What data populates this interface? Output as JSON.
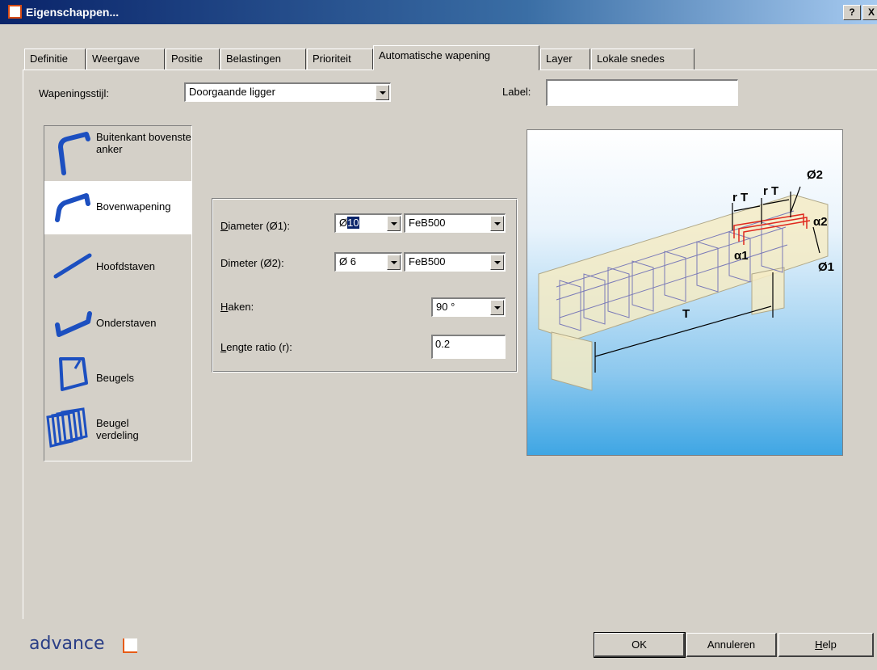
{
  "window": {
    "title": "Eigenschappen...",
    "help_btn": "?",
    "close_btn": "X"
  },
  "tabs": [
    {
      "label": "Definitie"
    },
    {
      "label": "Weergave"
    },
    {
      "label": "Positie"
    },
    {
      "label": "Belastingen"
    },
    {
      "label": "Prioriteit"
    },
    {
      "label": "Automatische wapening"
    },
    {
      "label": "Layer"
    },
    {
      "label": "Lokale snedes"
    }
  ],
  "active_tab": "Automatische wapening",
  "style": {
    "label": "Wapeningsstijl:",
    "value": "Doorgaande ligger"
  },
  "label_field": {
    "label": "Label:",
    "value": ""
  },
  "bar_types": [
    {
      "label": "Buitenkant bovenste anker",
      "icon": "top-anchor-bar-icon"
    },
    {
      "label": "Bovenwapening",
      "icon": "top-reinforcement-bar-icon",
      "selected": true
    },
    {
      "label": "Hoofdstaven",
      "icon": "main-bar-icon"
    },
    {
      "label": "Onderstaven",
      "icon": "bottom-bar-icon"
    },
    {
      "label": "Beugels",
      "icon": "stirrup-icon"
    },
    {
      "label": "Beugel verdeling",
      "icon": "stirrup-distribution-icon"
    }
  ],
  "settings": {
    "diameter1": {
      "prefix": "D",
      "label": "iameter (Ø1):",
      "symbol": "Ø",
      "value": "10",
      "grade": "FeB500"
    },
    "diameter2": {
      "prefix": "Di",
      "accel": "a",
      "label": "meter (Ø2):",
      "symbol": "Ø",
      "value": "6",
      "grade": "FeB500"
    },
    "hooks": {
      "prefix": "",
      "accel": "H",
      "label": "aken:",
      "value": "90 °"
    },
    "length_ratio": {
      "accel": "L",
      "label": "engte ratio (r):",
      "value": "0.2"
    }
  },
  "preview": {
    "labels": {
      "rT1": "r T",
      "rT2": "r T",
      "d2": "Ø2",
      "a2": "α2",
      "a1": "α1",
      "d1": "Ø1",
      "T": "T"
    }
  },
  "footer": {
    "logo": "advance",
    "ok": "OK",
    "cancel": "Annuleren",
    "help_accel": "H",
    "help_rest": "elp"
  },
  "colors": {
    "title_start": "#0a246a",
    "title_end": "#a6caf0",
    "accent": "#e65b15",
    "bar_blue": "#2255c4"
  }
}
